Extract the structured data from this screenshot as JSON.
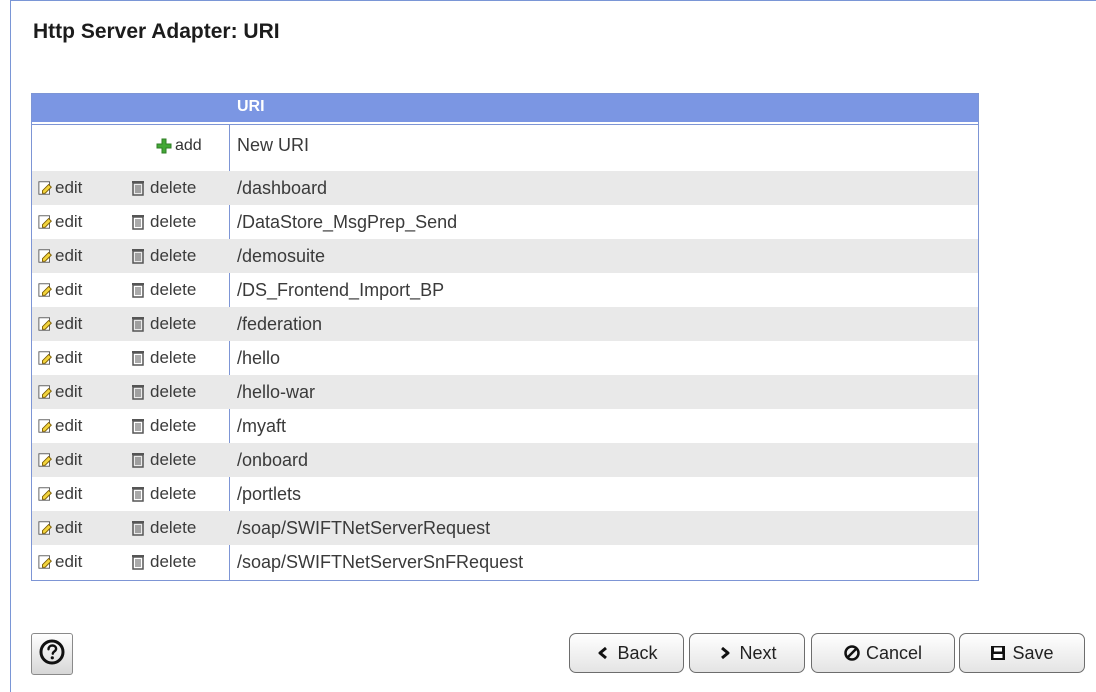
{
  "page": {
    "title": "Http Server Adapter: URI"
  },
  "grid": {
    "column_header": "URI",
    "add_row": {
      "add_label": "add",
      "value": "New URI"
    },
    "actions": {
      "edit_label": "edit",
      "delete_label": "delete"
    },
    "rows": [
      "/dashboard",
      "/DataStore_MsgPrep_Send",
      "/demosuite",
      "/DS_Frontend_Import_BP",
      "/federation",
      "/hello",
      "/hello-war",
      "/myaft",
      "/onboard",
      "/portlets",
      "/soap/SWIFTNetServerRequest",
      "/soap/SWIFTNetServerSnFRequest"
    ]
  },
  "buttons": {
    "back": "Back",
    "next": "Next",
    "cancel": "Cancel",
    "save": "Save"
  },
  "icons": {
    "help": "help-icon",
    "add": "add-icon",
    "edit": "edit-icon",
    "delete": "delete-icon",
    "back": "back-icon",
    "next": "next-icon",
    "cancel": "cancel-icon",
    "save": "save-icon"
  },
  "colors": {
    "header_blue": "#7b96e3",
    "border_blue": "#7d95d5",
    "stripe": "#e9e9e9",
    "add_green": "#3fa531"
  }
}
